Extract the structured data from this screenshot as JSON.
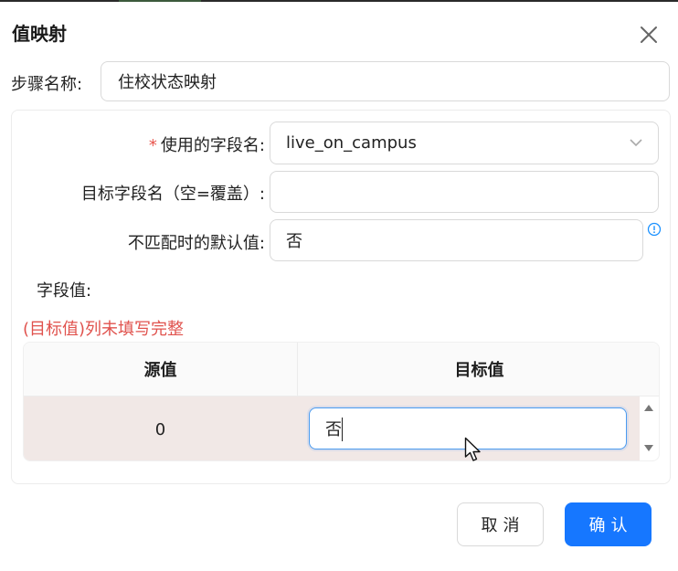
{
  "dialog": {
    "title": "值映射",
    "step_name_label": "步骤名称:",
    "step_name_value": "住校状态映射"
  },
  "form": {
    "field_name_label": "使用的字段名:",
    "field_name_required": "*",
    "field_name_value": "live_on_campus",
    "target_field_label": "目标字段名（空=覆盖）:",
    "target_field_value": "",
    "default_value_label": "不匹配时的默认值:",
    "default_value": "否",
    "field_values_label": "字段值:",
    "error_message": "(目标值)列未填写完整"
  },
  "table": {
    "headers": [
      "源值",
      "目标值"
    ],
    "rows": [
      {
        "source": "0",
        "target": "否"
      }
    ]
  },
  "footer": {
    "cancel_label": "取消",
    "ok_label": "确认"
  },
  "colors": {
    "primary": "#1677ff",
    "error": "#e0524d",
    "row_highlight": "#f1e8e6",
    "info": "#1890ff"
  },
  "icons": [
    "close-icon",
    "chevron-down-icon",
    "info-icon",
    "arrow-up-icon",
    "arrow-down-icon",
    "mouse-cursor-icon"
  ]
}
